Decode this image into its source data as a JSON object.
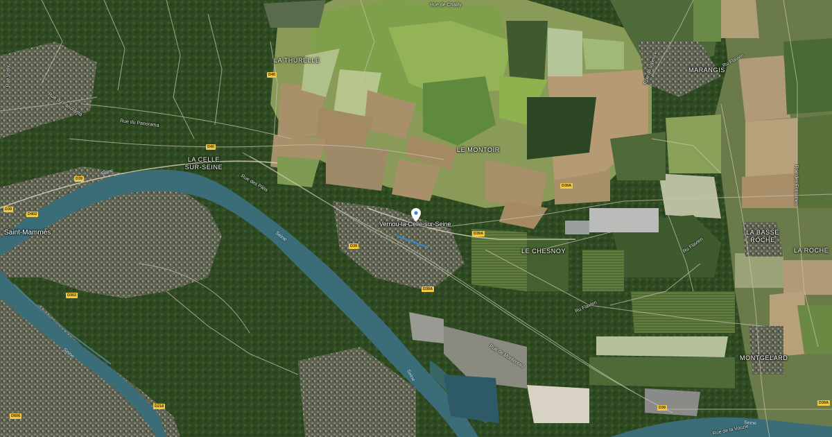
{
  "map": {
    "place_label": "Vernou-la-Celle-sur-Seine",
    "pin_icon": "map-pin-icon",
    "localities": [
      "LA THURELLE",
      "LA CELLE",
      "SUR-SEINE",
      "LE MONTOIR",
      "MARANGIS",
      "LE CHESNOY",
      "LA BASSE",
      "ROCHE",
      "LA ROCHE",
      "MONTGELARD",
      "Saint-Mammès"
    ],
    "streets": [
      "Rue de Chailly",
      "Rue du Panorama",
      "Rue du Panorama",
      "Rue des Pâlis",
      "Rue de Montereau",
      "Ru Flavien",
      "Ru Flavien",
      "Ru Flavien",
      "Rue des Fontaines",
      "Rue de Valence",
      "Rue Voisy",
      "Rue de la Vouzie"
    ],
    "water": [
      "Seine",
      "Seine",
      "Seine",
      "Seine",
      "Seine"
    ],
    "roads": [
      "D40",
      "D40",
      "D39",
      "D39",
      "D39",
      "D39A",
      "D39A",
      "D39A",
      "D39A",
      "D39",
      "D606",
      "D402",
      "D218",
      "D302"
    ],
    "colors": {
      "forest": "#2f4a22",
      "field_green": "#7ea04a",
      "field_tan": "#a8906a",
      "river": "#3b6d78",
      "road": "#c9c2b0"
    }
  }
}
